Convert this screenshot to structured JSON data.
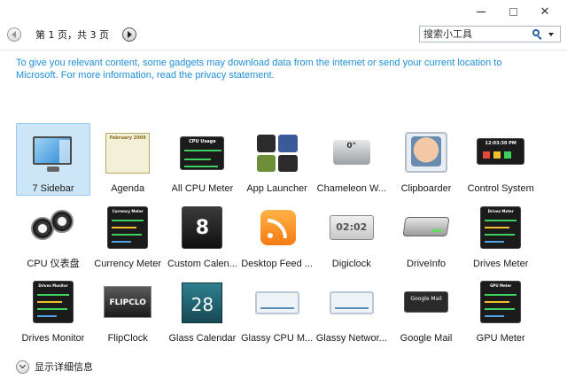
{
  "window": {
    "minimize_icon": "minimize-icon",
    "maximize_icon": "maximize-icon",
    "close_icon": "close-icon"
  },
  "pager": {
    "label": "第 1 页，共 3 页",
    "current": 1,
    "total": 3
  },
  "search": {
    "placeholder": "搜索小工具"
  },
  "notice": "To give you relevant content, some gadgets may download data from the internet or send your current location to Microsoft. For more information, read the privacy statement.",
  "gadgets": [
    {
      "label": "7 Sidebar",
      "selected": true,
      "icon": "monitor-icon"
    },
    {
      "label": "Agenda",
      "icon": "calendar-grid-icon",
      "thumb_text": "February 2009"
    },
    {
      "label": "All CPU Meter",
      "icon": "cpu-graph-icon",
      "thumb_text": "CPU Usage"
    },
    {
      "label": "App Launcher",
      "icon": "app-grid-icon"
    },
    {
      "label": "Chameleon W...",
      "icon": "weather-icon",
      "thumb_text": "0°"
    },
    {
      "label": "Clipboarder",
      "icon": "photo-icon"
    },
    {
      "label": "Control System",
      "icon": "control-panel-icon",
      "thumb_text": "12:03:30 PM"
    },
    {
      "label": "CPU 仪表盘",
      "icon": "dial-gauge-icon"
    },
    {
      "label": "Currency Meter",
      "icon": "currency-list-icon",
      "thumb_text": "Currency Meter"
    },
    {
      "label": "Custom Calen...",
      "icon": "date-calendar-icon",
      "thumb_text": "8"
    },
    {
      "label": "Desktop Feed ...",
      "icon": "rss-icon"
    },
    {
      "label": "Digiclock",
      "icon": "digital-clock-icon",
      "thumb_text": "02:02"
    },
    {
      "label": "DriveInfo",
      "icon": "hard-drive-icon"
    },
    {
      "label": "Drives Meter",
      "icon": "drives-graph-icon",
      "thumb_text": "Drives Meter"
    },
    {
      "label": "Drives Monitor",
      "icon": "drives-monitor-icon",
      "thumb_text": "Drives Monitor"
    },
    {
      "label": "FlipClock",
      "icon": "flip-clock-icon",
      "thumb_text": "FLIPCLO"
    },
    {
      "label": "Glass Calendar",
      "icon": "glass-calendar-icon",
      "thumb_text": "28"
    },
    {
      "label": "Glassy CPU M...",
      "icon": "glass-cpu-icon"
    },
    {
      "label": "Glassy Networ...",
      "icon": "glass-network-icon"
    },
    {
      "label": "Google Mail",
      "icon": "mail-icon",
      "thumb_text": "Google Mail"
    },
    {
      "label": "GPU Meter",
      "icon": "gpu-graph-icon",
      "thumb_text": "GPU Meter"
    }
  ],
  "footer": {
    "details_label": "显示详细信息"
  },
  "colors": {
    "accent_link": "#1e8fd6",
    "selected_bg": "#cde6f7",
    "selected_border": "#99c9ee"
  }
}
